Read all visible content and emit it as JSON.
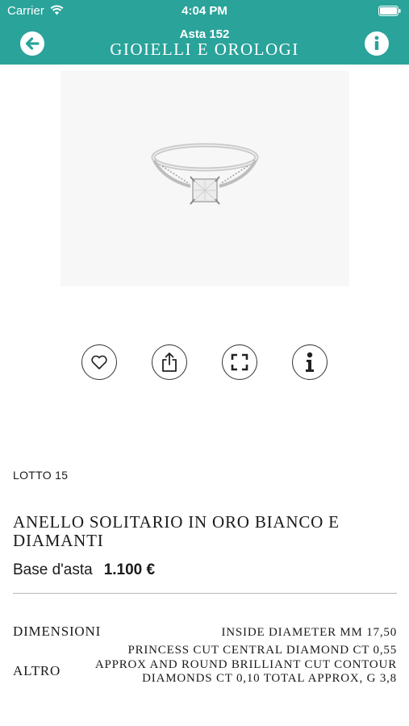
{
  "status_bar": {
    "carrier": "Carrier",
    "time": "4:04 PM"
  },
  "nav": {
    "subtitle": "Asta 152",
    "title": "GIOIELLI E OROLOGI"
  },
  "colors": {
    "accent": "#2aa39a",
    "text": "#1a1a1a"
  },
  "actions": [
    {
      "icon": "heart-icon"
    },
    {
      "icon": "share-icon"
    },
    {
      "icon": "fullscreen-icon"
    },
    {
      "icon": "info-icon"
    }
  ],
  "lot": {
    "label": "LOTTO 15",
    "title": "ANELLO SOLITARIO IN ORO BIANCO E DIAMANTI",
    "base_label": "Base d'asta",
    "base_value": "1.100 €"
  },
  "specs": [
    {
      "label": "DIMENSIONI",
      "value": "INSIDE DIAMETER MM 17,50"
    },
    {
      "label": "ALTRO",
      "value": "PRINCESS CUT CENTRAL DIAMOND CT 0,55 APPROX AND ROUND BRILLIANT CUT CONTOUR DIAMONDS CT 0,10 TOTAL APPROX, G 3,8"
    }
  ]
}
